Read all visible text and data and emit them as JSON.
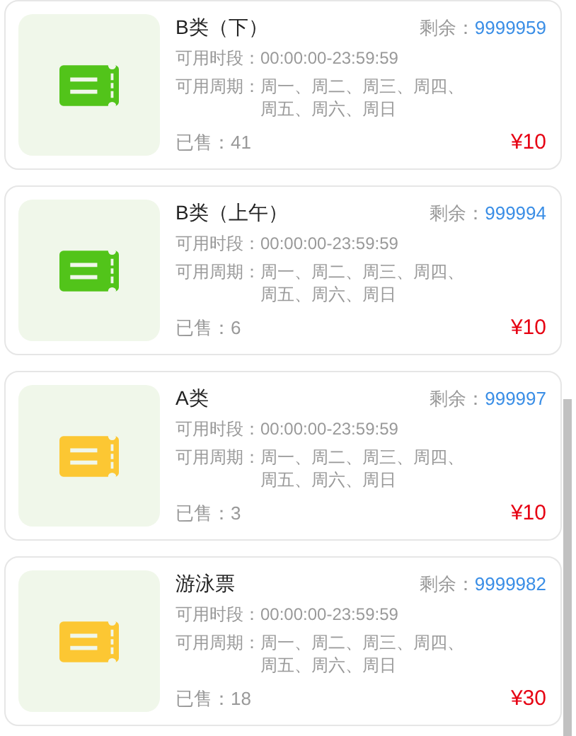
{
  "tickets": [
    {
      "name": "B类（下）",
      "remaining_label": "剩余：",
      "remaining": "9999959",
      "time_label": "可用时段：",
      "time": "00:00:00-23:59:59",
      "period_label": "可用周期：",
      "period": "周一、周二、周三、周四、周五、周六、周日",
      "sold_label": "已售：",
      "sold": "41",
      "price": "¥10",
      "color": "#52c41a"
    },
    {
      "name": "B类（上午）",
      "remaining_label": "剩余：",
      "remaining": "999994",
      "time_label": "可用时段：",
      "time": "00:00:00-23:59:59",
      "period_label": "可用周期：",
      "period": "周一、周二、周三、周四、周五、周六、周日",
      "sold_label": "已售：",
      "sold": "6",
      "price": "¥10",
      "color": "#52c41a"
    },
    {
      "name": "A类",
      "remaining_label": "剩余：",
      "remaining": "999997",
      "time_label": "可用时段：",
      "time": "00:00:00-23:59:59",
      "period_label": "可用周期：",
      "period": "周一、周二、周三、周四、周五、周六、周日",
      "sold_label": "已售：",
      "sold": "3",
      "price": "¥10",
      "color": "#fcc733"
    },
    {
      "name": "游泳票",
      "remaining_label": "剩余：",
      "remaining": "9999982",
      "time_label": "可用时段：",
      "time": "00:00:00-23:59:59",
      "period_label": "可用周期：",
      "period": "周一、周二、周三、周四、周五、周六、周日",
      "sold_label": "已售：",
      "sold": "18",
      "price": "¥30",
      "color": "#fcc733"
    }
  ]
}
